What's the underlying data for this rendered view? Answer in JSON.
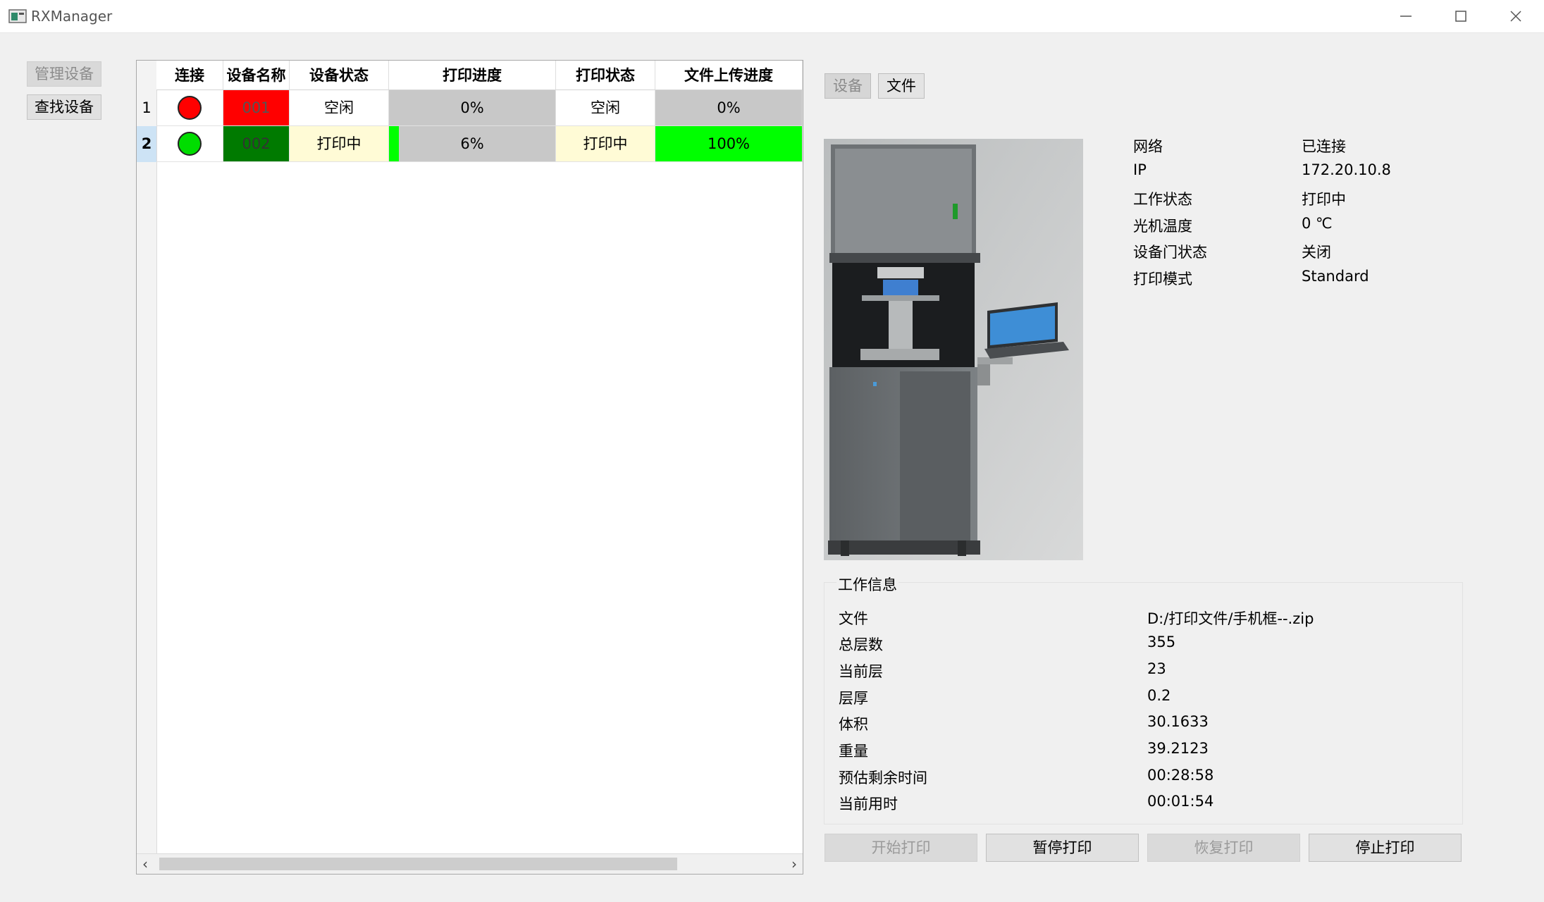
{
  "window": {
    "title": "RXManager"
  },
  "sidebar": {
    "manage_label": "管理设备",
    "find_label": "查找设备"
  },
  "table": {
    "headers": [
      "连接",
      "设备名称",
      "设备状态",
      "打印进度",
      "打印状态",
      "文件上传进度"
    ],
    "rows": [
      {
        "num": "1",
        "connected": false,
        "name": "001",
        "device_state": "空闲",
        "print_progress": "0%",
        "print_progress_fraction": 0,
        "print_state": "空闲",
        "upload_progress": "0%",
        "upload_fraction": 0
      },
      {
        "num": "2",
        "connected": true,
        "name": "002",
        "device_state": "打印中",
        "print_progress": "6%",
        "print_progress_fraction": 0.06,
        "print_state": "打印中",
        "upload_progress": "100%",
        "upload_fraction": 1.0
      }
    ]
  },
  "tabs": {
    "device": "设备",
    "file": "文件"
  },
  "device_info": {
    "labels": [
      "网络",
      "IP",
      "工作状态",
      "光机温度",
      "设备门状态",
      "打印模式"
    ],
    "values": [
      "已连接",
      "172.20.10.8",
      "打印中",
      "0 ℃",
      "关闭",
      "Standard"
    ]
  },
  "work_info": {
    "title": "工作信息",
    "labels": [
      "文件",
      "总层数",
      "当前层",
      "层厚",
      "体积",
      "重量",
      "预估剩余时间",
      "当前用时"
    ],
    "values": [
      "D:/打印文件/手机框--.zip",
      "355",
      "23",
      "0.2",
      "30.1633",
      "39.2123",
      "00:28:58",
      "00:01:54"
    ]
  },
  "actions": {
    "start": "开始打印",
    "pause": "暂停打印",
    "resume": "恢复打印",
    "stop": "停止打印"
  },
  "colors": {
    "offline_led": "#ff0000",
    "online_led": "#00dd00",
    "name_offline_bg": "#ff0000",
    "name_online_bg": "#007a00",
    "idle_bg": "#ffffff",
    "printing_bg": "#fffbd6",
    "progress_bg": "#c8c8c8",
    "progress_fill": "#00ff00",
    "selected_row": "#cde3f5"
  }
}
